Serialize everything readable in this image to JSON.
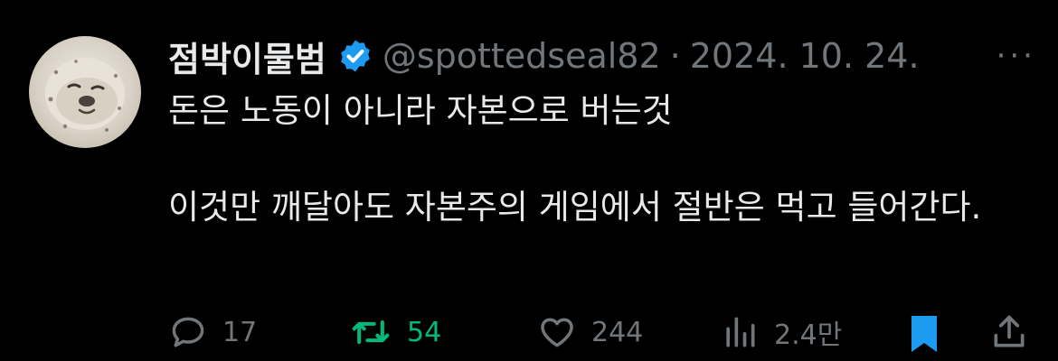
{
  "tweet": {
    "display_name": "점박이물범",
    "handle": "@spottedseal82",
    "separator": "·",
    "date": "2024. 10. 24.",
    "more_label": "···",
    "text_line1": "돈은 노동이 아니라 자본으로 버는것",
    "text_line2": "이것만 깨달아도 자본주의 게임에서 절반은 먹고 들어간다."
  },
  "actions": {
    "replies": "17",
    "retweets": "54",
    "likes": "244",
    "views": "2.4만"
  },
  "colors": {
    "background": "#000000",
    "text": "#e7e9ea",
    "muted": "#71767b",
    "verified": "#1d9bf0",
    "retweet_active": "#00ba7c",
    "bookmark_active": "#1d9bf0"
  },
  "icons": {
    "verified": "verified-badge-icon",
    "reply": "reply-icon",
    "retweet": "retweet-icon",
    "like": "heart-icon",
    "views": "views-icon",
    "bookmark": "bookmark-icon",
    "share": "share-icon"
  }
}
